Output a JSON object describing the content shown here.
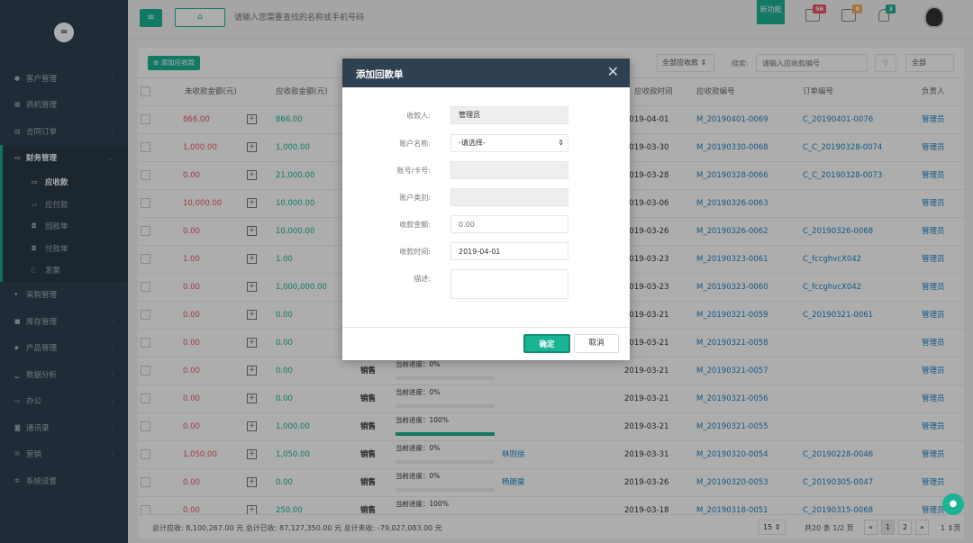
{
  "colors": {
    "accent": "#1ab394",
    "sidebar": "#2f4050",
    "danger": "#ed5565",
    "link": "#1c84c6"
  },
  "topbar": {
    "menu_icon": "≡",
    "home_icon": "⌂",
    "search_placeholder": "请输入您需要查找的名称或手机号码",
    "new_feature": "新功能",
    "badge1": "56",
    "badge2": "8",
    "badge3": "3"
  },
  "sidebar": {
    "items": [
      {
        "label": "客户管理",
        "icon": "user-icon"
      },
      {
        "label": "商机管理",
        "icon": "chart-icon"
      },
      {
        "label": "合同订单",
        "icon": "list-icon"
      },
      {
        "label": "财务管理",
        "icon": "wallet-icon"
      },
      {
        "label": "采购管理",
        "icon": "cart-icon"
      },
      {
        "label": "库存管理",
        "icon": "box-icon"
      },
      {
        "label": "产品管理",
        "icon": "grid-icon"
      },
      {
        "label": "数据分析",
        "icon": "bar-icon"
      },
      {
        "label": "办公",
        "icon": "monitor-icon"
      },
      {
        "label": "通讯录",
        "icon": "contact-icon"
      },
      {
        "label": "营销",
        "icon": "mail-icon"
      },
      {
        "label": "系统设置",
        "icon": "gear-icon"
      }
    ],
    "sub": [
      "应收款",
      "应付款",
      "回款单",
      "付款单",
      "发票"
    ]
  },
  "toolbar": {
    "add_label": "添加应收款",
    "filter1": "全部应收款 ⇕",
    "search_label": "搜索:",
    "search_placeholder": "请输入应收款编号",
    "filter2": "全部"
  },
  "table": {
    "headers": [
      "未收款金额(元)",
      "应收款金额(元)",
      "应收款时间",
      "应收款编号",
      "订单编号",
      "负责人"
    ],
    "rows": [
      {
        "unpaid": "866.00",
        "amount": "866.00",
        "type": "",
        "progress_label": "",
        "progress": 0,
        "contact": "",
        "date": "2019-04-01",
        "no": "M_20190401-0069",
        "order": "C_20190401-0076",
        "owner": "管理员"
      },
      {
        "unpaid": "1,000.00",
        "amount": "1,000.00",
        "type": "",
        "progress_label": "",
        "progress": 0,
        "contact": "",
        "date": "2019-03-30",
        "no": "M_20190330-0068",
        "order": "C_C_20190328-0074",
        "owner": "管理员"
      },
      {
        "unpaid": "0.00",
        "amount": "21,000.00",
        "type": "",
        "progress_label": "",
        "progress": 0,
        "contact": "",
        "date": "2019-03-28",
        "no": "M_20190328-0066",
        "order": "C_C_20190328-0073",
        "owner": "管理员"
      },
      {
        "unpaid": "10,000.00",
        "amount": "10,000.00",
        "type": "",
        "progress_label": "",
        "progress": 0,
        "contact": "",
        "date": "2019-03-06",
        "no": "M_20190326-0063",
        "order": "",
        "owner": "管理员"
      },
      {
        "unpaid": "0.00",
        "amount": "10,000.00",
        "type": "",
        "progress_label": "",
        "progress": 0,
        "contact": "",
        "date": "2019-03-26",
        "no": "M_20190326-0062",
        "order": "C_20190326-0068",
        "owner": "管理员"
      },
      {
        "unpaid": "1.00",
        "amount": "1.00",
        "type": "",
        "progress_label": "",
        "progress": 0,
        "contact": "",
        "date": "2019-03-23",
        "no": "M_20190323-0061",
        "order": "C_fccghvcX042",
        "owner": "管理员"
      },
      {
        "unpaid": "0.00",
        "amount": "1,000,000.00",
        "type": "",
        "progress_label": "",
        "progress": 0,
        "contact": "",
        "date": "2019-03-23",
        "no": "M_20190323-0060",
        "order": "C_fccghvcX042",
        "owner": "管理员"
      },
      {
        "unpaid": "0.00",
        "amount": "0.00",
        "type": "",
        "progress_label": "",
        "progress": 0,
        "contact": "",
        "date": "2019-03-21",
        "no": "M_20190321-0059",
        "order": "C_20190321-0061",
        "owner": "管理员"
      },
      {
        "unpaid": "0.00",
        "amount": "0.00",
        "type": "",
        "progress_label": "",
        "progress": 0,
        "contact": "",
        "date": "2019-03-21",
        "no": "M_20190321-0058",
        "order": "",
        "owner": "管理员"
      },
      {
        "unpaid": "0.00",
        "amount": "0.00",
        "type": "销售",
        "progress_label": "当前进度：0%",
        "progress": 0,
        "contact": "",
        "date": "2019-03-21",
        "no": "M_20190321-0057",
        "order": "",
        "owner": "管理员"
      },
      {
        "unpaid": "0.00",
        "amount": "0.00",
        "type": "销售",
        "progress_label": "当前进度：0%",
        "progress": 0,
        "contact": "",
        "date": "2019-03-21",
        "no": "M_20190321-0056",
        "order": "",
        "owner": "管理员"
      },
      {
        "unpaid": "0.00",
        "amount": "1,000.00",
        "type": "销售",
        "progress_label": "当前进度：100%",
        "progress": 1,
        "contact": "",
        "date": "2019-03-21",
        "no": "M_20190321-0055",
        "order": "",
        "owner": "管理员"
      },
      {
        "unpaid": "1,050.00",
        "amount": "1,050.00",
        "type": "销售",
        "progress_label": "当前进度：0%",
        "progress": 0,
        "contact": "林则徐",
        "date": "2019-03-31",
        "no": "M_20190320-0054",
        "order": "C_20190228-0046",
        "owner": "管理员"
      },
      {
        "unpaid": "0.00",
        "amount": "0.00",
        "type": "销售",
        "progress_label": "当前进度：0%",
        "progress": 0,
        "contact": "杨朗巢",
        "date": "2019-03-26",
        "no": "M_20190320-0053",
        "order": "C_20190305-0047",
        "owner": "管理员"
      },
      {
        "unpaid": "0.00",
        "amount": "250.00",
        "type": "销售",
        "progress_label": "当前进度：100%",
        "progress": 1,
        "contact": "",
        "date": "2019-03-18",
        "no": "M_20190318-0051",
        "order": "C_20190315-0068",
        "owner": "管理员"
      }
    ]
  },
  "footer": {
    "totals": "总计应收: 8,100,267.00 元 总计已收: 87,127,350.00 元 总计未收: -79,027,083.00 元",
    "page_size": "15 ⇕",
    "page_info": "共20 条 1/2 页",
    "prev": "«",
    "p1": "1",
    "p2": "2",
    "next": "»",
    "goto": "1 ⇕页"
  },
  "modal": {
    "title": "添加回款单",
    "close": "✕",
    "fields": {
      "payee_label": "收款人:",
      "payee_value": "管理员",
      "account_label": "账户名称:",
      "account_value": "-请选择-",
      "card_label": "账号/卡号:",
      "card_value": "",
      "type_label": "账户类别:",
      "type_value": "",
      "amount_label": "收款金额:",
      "amount_placeholder": "0.00",
      "date_label": "收款时间:",
      "date_value": "2019-04-01",
      "desc_label": "描述:"
    },
    "ok": "确定",
    "cancel": "取消"
  }
}
